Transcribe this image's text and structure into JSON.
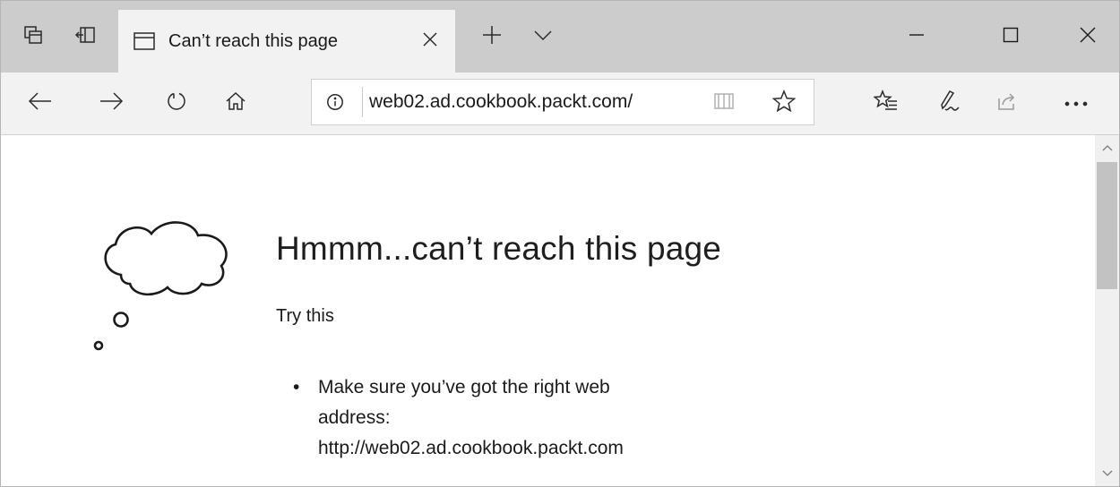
{
  "tabbar": {
    "tab": {
      "title": "Can’t reach this page"
    }
  },
  "toolbar": {
    "address": {
      "url": "web02.ad.cookbook.packt.com/"
    }
  },
  "content": {
    "heading": "Hmmm...can’t reach this page",
    "subheading": "Try this",
    "tips": [
      {
        "lines": [
          "Make sure you’ve got the right web",
          "address:",
          "http://web02.ad.cookbook.packt.com"
        ]
      }
    ]
  },
  "icons": {
    "tabbar": [
      "tab-preview-icon",
      "set-tabs-aside-icon",
      "page-tab-icon",
      "close-tab-icon",
      "new-tab-plus-icon",
      "tab-list-chevron-icon",
      "minimize-icon",
      "maximize-icon",
      "close-window-icon"
    ],
    "toolbar": [
      "back-arrow-icon",
      "forward-arrow-icon",
      "refresh-icon",
      "home-icon",
      "info-icon",
      "reading-view-icon",
      "favorite-star-icon",
      "favorites-hub-icon",
      "web-note-pen-icon",
      "share-icon",
      "more-ellipsis-icon"
    ],
    "content": [
      "thought-cloud-icon",
      "scroll-up-icon",
      "scroll-down-icon"
    ]
  }
}
